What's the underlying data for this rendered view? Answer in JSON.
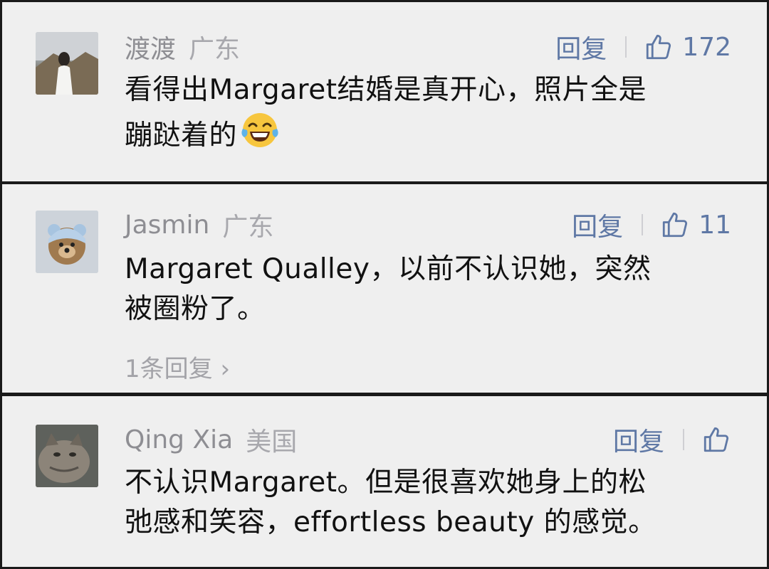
{
  "comments": [
    {
      "username": "渡渡",
      "location": "广东",
      "reply_label": "回复",
      "likes": "172",
      "text_line1": "看得出Margaret结婚是真开心，照片全是",
      "text_line2": "蹦跶着的",
      "emoji": "😂"
    },
    {
      "username": "Jasmin",
      "location": "广东",
      "reply_label": "回复",
      "likes": "11",
      "text_line1": "Margaret Qualley，以前不认识她，突然",
      "text_line2": "被圈粉了。",
      "more_replies": "1条回复 ›"
    },
    {
      "username": "Qing Xia",
      "location": "美国",
      "reply_label": "回复",
      "likes": "",
      "text_line1": "不认识Margaret。但是很喜欢她身上的松",
      "text_line2": "弛感和笑容，effortless beauty 的感觉。"
    }
  ],
  "colors": {
    "background": "#efefef",
    "separator": "#1a1a1a",
    "meta_text": "#8e8e93",
    "action_blue": "#5f78a5",
    "body_text": "#111111"
  },
  "icons": {
    "like": "thumbs-up-icon",
    "emoji": "tears-of-joy-emoji"
  }
}
